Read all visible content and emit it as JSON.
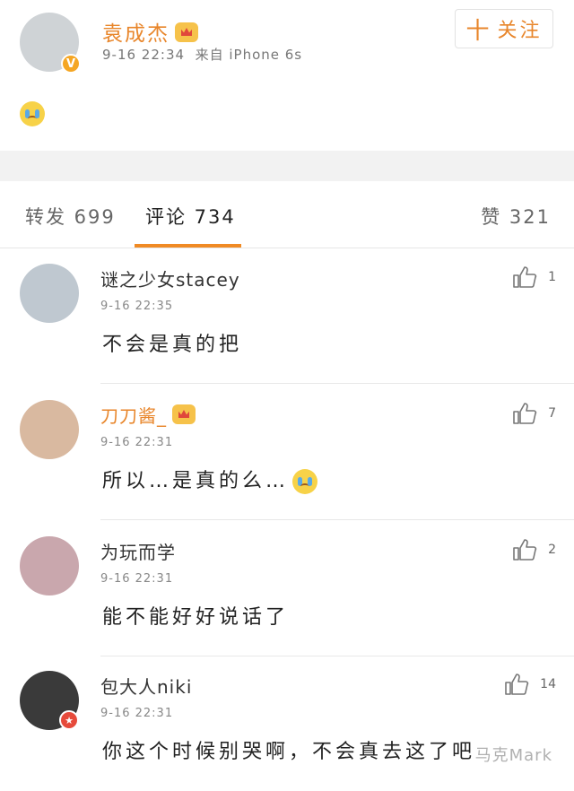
{
  "post": {
    "author": "袁成杰",
    "time": "9-16 22:34",
    "source": "来自 iPhone 6s",
    "follow_label": "关注",
    "follow_plus": "十",
    "verified_badge": "V",
    "content_emoji": "crying-face"
  },
  "tabs": [
    {
      "label": "转发 699"
    },
    {
      "label": "评论 734"
    },
    {
      "label": "赞 321"
    }
  ],
  "comments": [
    {
      "name": "谜之少女stacey",
      "time": "9-16 22:35",
      "text": "不会是真的把",
      "likes": "1",
      "avatar_color": "#bfc8d0"
    },
    {
      "name": "刀刀酱_",
      "time": "9-16 22:31",
      "text": "所以…是真的么…",
      "likes": "7",
      "avatar_color": "#d9b9a0"
    },
    {
      "name": "为玩而学",
      "time": "9-16 22:31",
      "text": "能不能好好说话了",
      "likes": "2",
      "avatar_color": "#c9a7ad"
    },
    {
      "name": "包大人niki",
      "time": "9-16 22:31",
      "text": "你这个时候别哭啊，不会真去这了吧",
      "likes": "14",
      "avatar_color": "#3a3a3a"
    }
  ],
  "watermark": "马克Mark",
  "colors": {
    "accent": "#f08a24",
    "vip_name": "#e8862b"
  }
}
